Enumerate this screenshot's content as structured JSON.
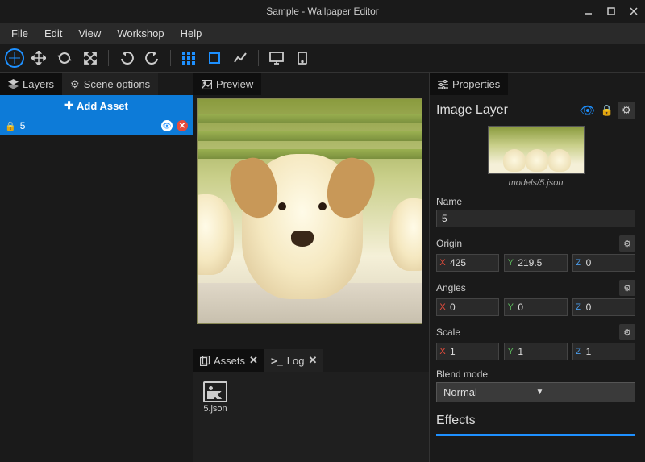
{
  "title": "Sample - Wallpaper Editor",
  "menu": [
    "File",
    "Edit",
    "View",
    "Workshop",
    "Help"
  ],
  "left_tabs": {
    "layers": "Layers",
    "scene": "Scene options"
  },
  "add_asset": "Add Asset",
  "layer": {
    "name": "5"
  },
  "preview_tab": "Preview",
  "asset_tabs": {
    "assets": "Assets",
    "log": "Log"
  },
  "asset_item": "5.json",
  "props_tab": "Properties",
  "props": {
    "title": "Image Layer",
    "thumb_label": "models/5.json",
    "name_label": "Name",
    "name_value": "5",
    "origin_label": "Origin",
    "origin": {
      "x": "425",
      "y": "219.5",
      "z": "0"
    },
    "angles_label": "Angles",
    "angles": {
      "x": "0",
      "y": "0",
      "z": "0"
    },
    "scale_label": "Scale",
    "scale": {
      "x": "1",
      "y": "1",
      "z": "1"
    },
    "blend_label": "Blend mode",
    "blend_value": "Normal",
    "effects_label": "Effects"
  }
}
